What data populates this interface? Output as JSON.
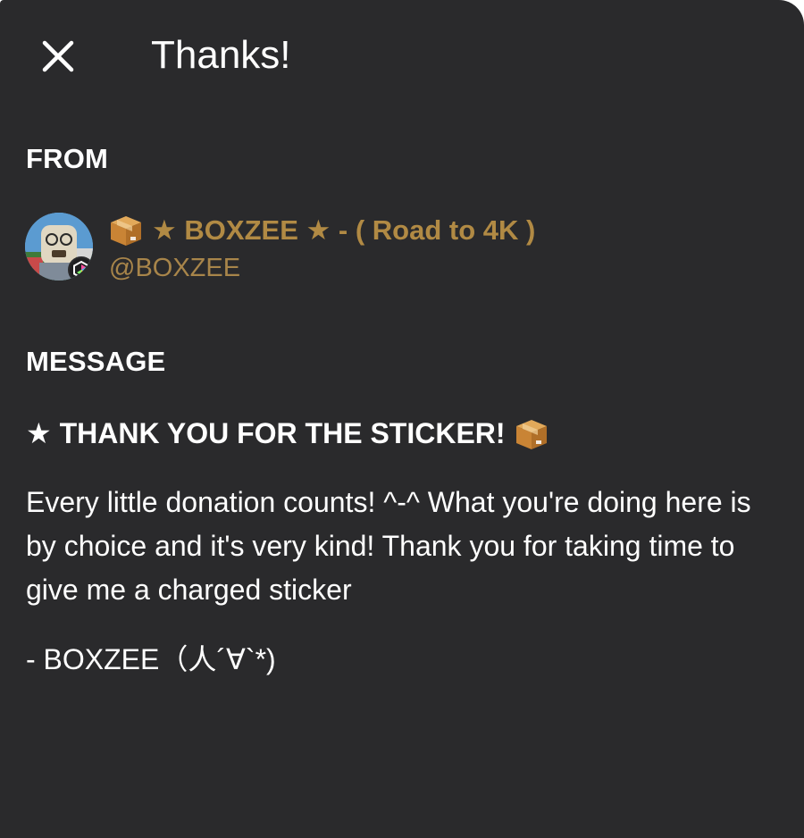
{
  "header": {
    "close_icon": "close-icon",
    "title": "Thanks!"
  },
  "from": {
    "label": "FROM",
    "sender": {
      "avatar_icon": "avatar",
      "badge_icon": "hexagon-badge-icon",
      "name_prefix_icon": "package-box-icon",
      "name": "★ BOXZEE ★ - ( Road to 4K )",
      "handle": "@BOXZEE",
      "name_color": "#b18a44"
    }
  },
  "message": {
    "label": "MESSAGE",
    "headline": "★ THANK YOU FOR THE STICKER!",
    "headline_suffix_icon": "package-box-icon",
    "body": "Every little donation counts! ^-^ What you're doing here is by choice and it's very kind! Thank you for taking time to give me a charged sticker",
    "signoff": "- BOXZEE（人´∀`*)"
  },
  "colors": {
    "background": "#2a2a2c",
    "text": "#ffffff",
    "accent": "#b18a44"
  }
}
